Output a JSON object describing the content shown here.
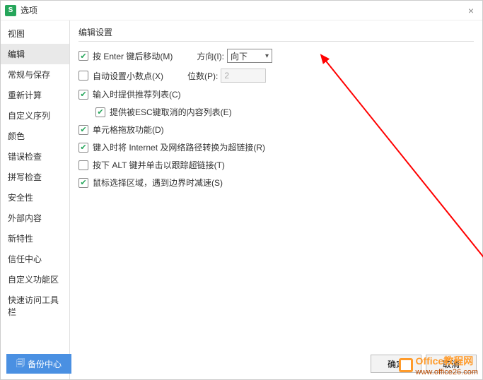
{
  "title": "选项",
  "close": "×",
  "sidebar": {
    "items": [
      {
        "label": "视图"
      },
      {
        "label": "编辑"
      },
      {
        "label": "常规与保存"
      },
      {
        "label": "重新计算"
      },
      {
        "label": "自定义序列"
      },
      {
        "label": "颜色"
      },
      {
        "label": "错误检查"
      },
      {
        "label": "拼写检查"
      },
      {
        "label": "安全性"
      },
      {
        "label": "外部内容"
      },
      {
        "label": "新特性"
      },
      {
        "label": "信任中心"
      },
      {
        "label": "自定义功能区"
      },
      {
        "label": "快速访问工具栏"
      }
    ],
    "activeIndex": 1
  },
  "content": {
    "sectionTitle": "编辑设置",
    "enterMove": {
      "label": "按 Enter 键后移动(M)",
      "checked": true
    },
    "direction": {
      "label": "方向(I):",
      "value": "向下"
    },
    "autoDecimal": {
      "label": "自动设置小数点(X)",
      "checked": false
    },
    "digits": {
      "label": "位数(P):",
      "value": "2"
    },
    "pushList": {
      "label": "输入时提供推荐列表(C)",
      "checked": true
    },
    "escList": {
      "label": "提供被ESC键取消的内容列表(E)",
      "checked": true
    },
    "dragFill": {
      "label": "单元格拖放功能(D)",
      "checked": true
    },
    "hyperlink": {
      "label": "键入时将 Internet 及网络路径转换为超链接(R)",
      "checked": true
    },
    "altClick": {
      "label": "按下 ALT 键并单击以跟踪超链接(T)",
      "checked": false
    },
    "mouseSlow": {
      "label": "鼠标选择区域，遇到边界时减速(S)",
      "checked": true
    }
  },
  "footer": {
    "backup": "备份中心",
    "ok": "确定",
    "cancel": "取消"
  },
  "watermark": {
    "line1": "Office教程网",
    "line2": "www.office26.com"
  }
}
